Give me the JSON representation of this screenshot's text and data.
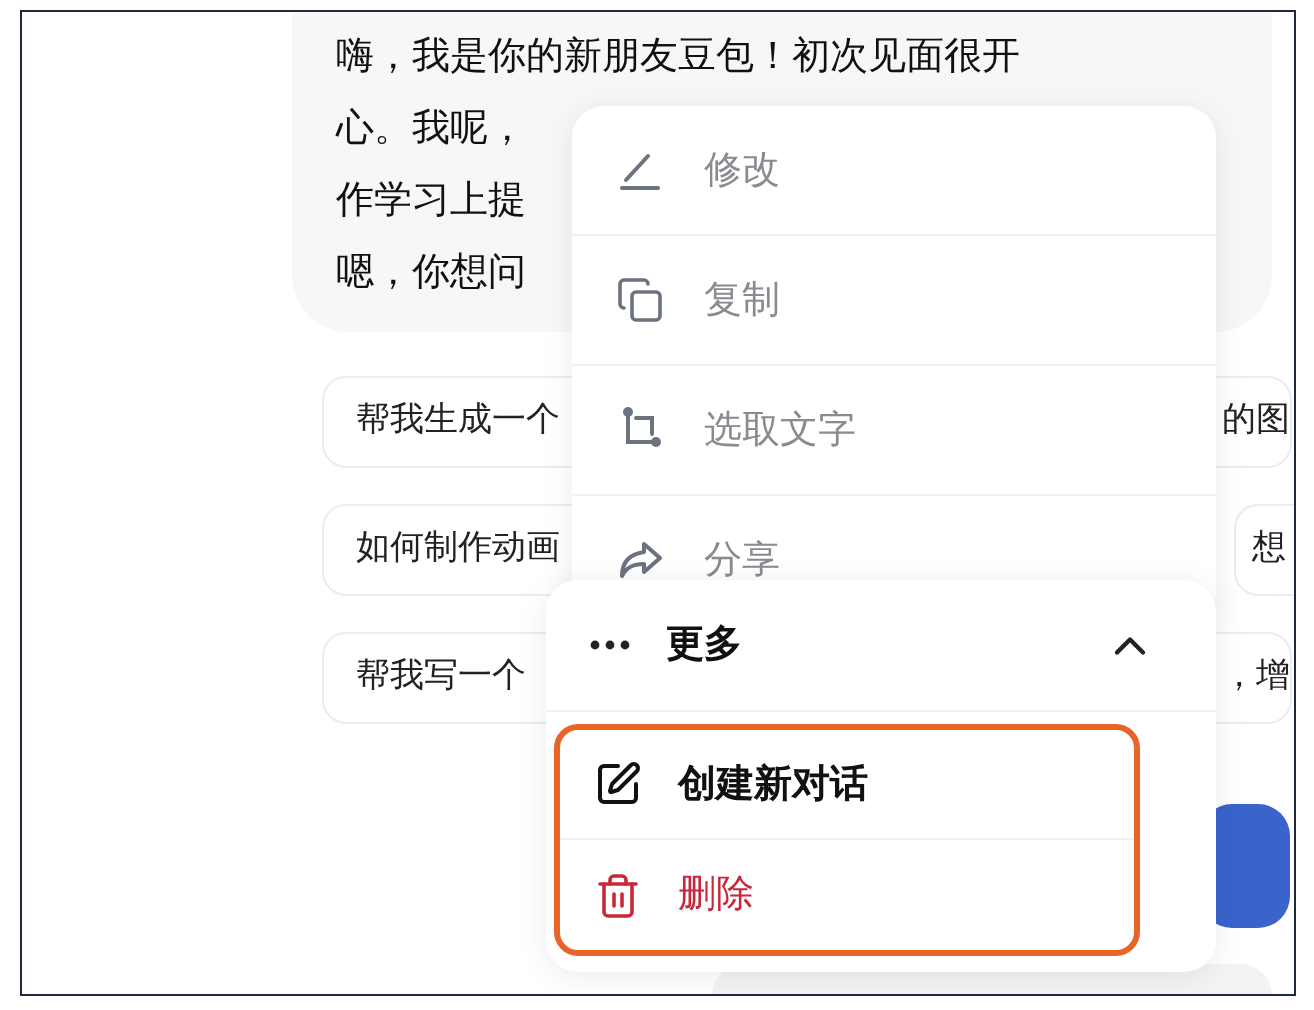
{
  "message": {
    "lines": [
      "嗨，我是你的新朋友豆包！初次见面很开",
      "心。我呢，",
      "作学习上提",
      "嗯，你想问"
    ]
  },
  "suggestions": [
    {
      "chips": [
        {
          "text": "帮我生成一个",
          "tail": "的图"
        }
      ]
    },
    {
      "chips": [
        {
          "text": "如何制作动画"
        },
        {
          "text": "想"
        }
      ]
    },
    {
      "chips": [
        {
          "text": "帮我写一个",
          "tail": "，增"
        }
      ]
    }
  ],
  "context_menu": {
    "items": [
      {
        "kind": "edit",
        "label": "修改"
      },
      {
        "kind": "copy",
        "label": "复制"
      },
      {
        "kind": "select",
        "label": "选取文字"
      },
      {
        "kind": "share",
        "label": "分享"
      }
    ]
  },
  "more_menu": {
    "label": "更多",
    "expanded": true,
    "highlighted": true,
    "items": [
      {
        "kind": "new",
        "label": "创建新对话"
      },
      {
        "kind": "delete",
        "label": "删除"
      }
    ]
  }
}
